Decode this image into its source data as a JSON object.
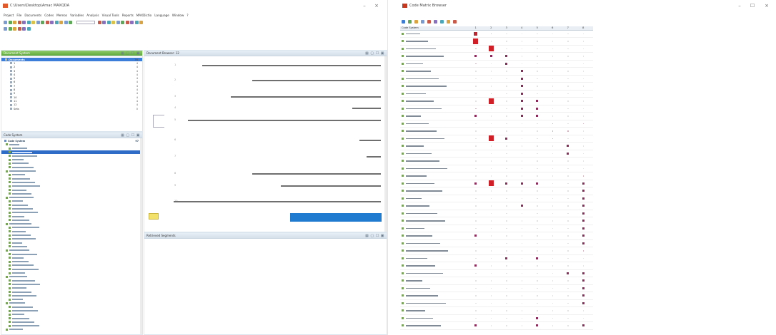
{
  "colors": {
    "selection": "#3b7dd8",
    "header_green": "#6fb84a",
    "matrix_node": "#c0252f"
  },
  "maxqda": {
    "title": "C:\\Users\\Desktop\\Arnac MAXQDA",
    "menus": [
      "Project",
      "File",
      "Documents",
      "Codes",
      "Memos",
      "Variables",
      "Analysis",
      "Visual Tools",
      "Reports",
      "MAXDictio",
      "Language",
      "Window",
      "?"
    ],
    "doc_tree": {
      "title": "Document System",
      "root": "Documents",
      "root_count": "76",
      "items": [
        {
          "label": "1",
          "count": "4"
        },
        {
          "label": "2",
          "count": "4"
        },
        {
          "label": "3",
          "count": "4"
        },
        {
          "label": "4",
          "count": "4"
        },
        {
          "label": "5",
          "count": "4"
        },
        {
          "label": "6",
          "count": "4"
        },
        {
          "label": "7",
          "count": "4"
        },
        {
          "label": "8",
          "count": "4"
        },
        {
          "label": "9",
          "count": "4"
        },
        {
          "label": "10",
          "count": "4"
        },
        {
          "label": "11",
          "count": "4"
        },
        {
          "label": "12",
          "count": "4"
        },
        {
          "label": "Sets",
          "count": "0"
        }
      ]
    },
    "code_system": {
      "title": "Code System",
      "root": "Code System",
      "root_count": "97",
      "items": [
        "",
        "",
        "",
        "",
        "",
        "",
        "",
        "",
        "",
        "",
        "",
        "",
        "",
        "",
        "",
        "",
        "",
        "",
        "",
        "",
        "",
        "",
        "",
        "",
        "",
        "",
        "",
        "",
        "",
        "",
        "",
        "",
        "",
        "",
        "",
        "",
        "",
        "",
        "",
        "",
        "",
        "",
        "",
        "",
        "",
        "",
        "",
        "",
        "",
        ""
      ]
    },
    "browser": {
      "title": "Document Browser: 12",
      "paragraph_numbers": [
        "1",
        "2",
        "3",
        "4",
        "5",
        "6",
        "7",
        "8",
        "9",
        "10"
      ],
      "paragraphs": [
        "",
        "",
        "",
        "",
        "",
        "",
        "",
        "",
        "",
        ""
      ]
    },
    "retrieved": {
      "title": "Retrieved Segments"
    }
  },
  "matrix": {
    "title": "Code Matrix Browser",
    "header_label": "Code System",
    "columns": [
      "1",
      "2",
      "3",
      "4",
      "5",
      "6",
      "7",
      "8"
    ],
    "rows": [
      {
        "cells": [
          "l",
          "s",
          "",
          "",
          "",
          "",
          "",
          ""
        ]
      },
      {
        "cells": [
          "xl",
          "",
          "",
          "",
          "",
          "",
          "",
          ""
        ]
      },
      {
        "cells": [
          "s",
          "xl",
          "",
          "",
          "",
          "",
          "",
          ""
        ]
      },
      {
        "cells": [
          "m",
          "m",
          "m",
          "",
          "",
          "",
          "",
          ""
        ]
      },
      {
        "cells": [
          "s",
          "",
          "m",
          "",
          "",
          "",
          "",
          ""
        ]
      },
      {
        "cells": [
          "",
          "",
          "",
          "m",
          "",
          "",
          "",
          ""
        ]
      },
      {
        "cells": [
          "",
          "",
          "",
          "m",
          "",
          "",
          "",
          ""
        ]
      },
      {
        "cells": [
          "",
          "",
          "",
          "m",
          "",
          "",
          "",
          ""
        ]
      },
      {
        "cells": [
          "",
          "s",
          "",
          "m",
          "",
          "",
          "",
          ""
        ]
      },
      {
        "cells": [
          "",
          "xl",
          "",
          "m",
          "m",
          "",
          "",
          ""
        ]
      },
      {
        "cells": [
          "s",
          "",
          "",
          "m",
          "m",
          "",
          "",
          ""
        ]
      },
      {
        "cells": [
          "m",
          "",
          "",
          "m",
          "m",
          "",
          "",
          ""
        ]
      },
      {
        "cells": [
          "",
          "",
          "",
          "",
          "",
          "s",
          "",
          "s"
        ]
      },
      {
        "cells": [
          "",
          "",
          "",
          "",
          "",
          "s",
          "s",
          ""
        ]
      },
      {
        "cells": [
          "",
          "xl",
          "m",
          "",
          "",
          "s",
          "",
          ""
        ]
      },
      {
        "cells": [
          "",
          "",
          "",
          "",
          "",
          "",
          "m",
          ""
        ]
      },
      {
        "cells": [
          "",
          "",
          "",
          "",
          "",
          "",
          "m",
          ""
        ]
      },
      {
        "cells": [
          "",
          "",
          "",
          "",
          "",
          "",
          "",
          ""
        ]
      },
      {
        "cells": [
          "",
          "",
          "",
          "",
          "",
          "",
          "",
          ""
        ]
      },
      {
        "cells": [
          "",
          "",
          "",
          "",
          "",
          "",
          "",
          "s"
        ]
      },
      {
        "cells": [
          "m",
          "xl",
          "m",
          "m",
          "m",
          "",
          "",
          "m"
        ]
      },
      {
        "cells": [
          "",
          "",
          "",
          "",
          "",
          "",
          "",
          "m"
        ]
      },
      {
        "cells": [
          "",
          "",
          "",
          "",
          "",
          "",
          "",
          "m"
        ]
      },
      {
        "cells": [
          "",
          "",
          "",
          "m",
          "",
          "",
          "",
          "m"
        ]
      },
      {
        "cells": [
          "",
          "",
          "",
          "",
          "",
          "",
          "",
          "m"
        ]
      },
      {
        "cells": [
          "",
          "",
          "",
          "",
          "",
          "",
          "",
          "m"
        ]
      },
      {
        "cells": [
          "",
          "",
          "",
          "",
          "",
          "",
          "",
          "m"
        ]
      },
      {
        "cells": [
          "m",
          "",
          "",
          "",
          "",
          "",
          "",
          "m"
        ]
      },
      {
        "cells": [
          "",
          "",
          "",
          "",
          "",
          "",
          "",
          "m"
        ]
      },
      {
        "cells": [
          "",
          "",
          "",
          "",
          "",
          "",
          "",
          "s"
        ]
      },
      {
        "cells": [
          "",
          "",
          "m",
          "",
          "m",
          "",
          "",
          ""
        ]
      },
      {
        "cells": [
          "m",
          "",
          "",
          "",
          "",
          "",
          "",
          ""
        ]
      },
      {
        "cells": [
          "",
          "",
          "",
          "",
          "",
          "",
          "m",
          "m"
        ]
      },
      {
        "cells": [
          "",
          "",
          "",
          "",
          "",
          "",
          "",
          "m"
        ]
      },
      {
        "cells": [
          "",
          "",
          "",
          "",
          "",
          "",
          "",
          "m"
        ]
      },
      {
        "cells": [
          "",
          "",
          "",
          "",
          "",
          "",
          "",
          "m"
        ]
      },
      {
        "cells": [
          "",
          "",
          "",
          "",
          "",
          "",
          "",
          "m"
        ]
      },
      {
        "cells": [
          "",
          "",
          "",
          "",
          "",
          "",
          "",
          ""
        ]
      },
      {
        "cells": [
          "",
          "",
          "",
          "",
          "m",
          "",
          "",
          ""
        ]
      },
      {
        "cells": [
          "m",
          "",
          "",
          "",
          "m",
          "",
          "",
          "m"
        ]
      }
    ]
  }
}
